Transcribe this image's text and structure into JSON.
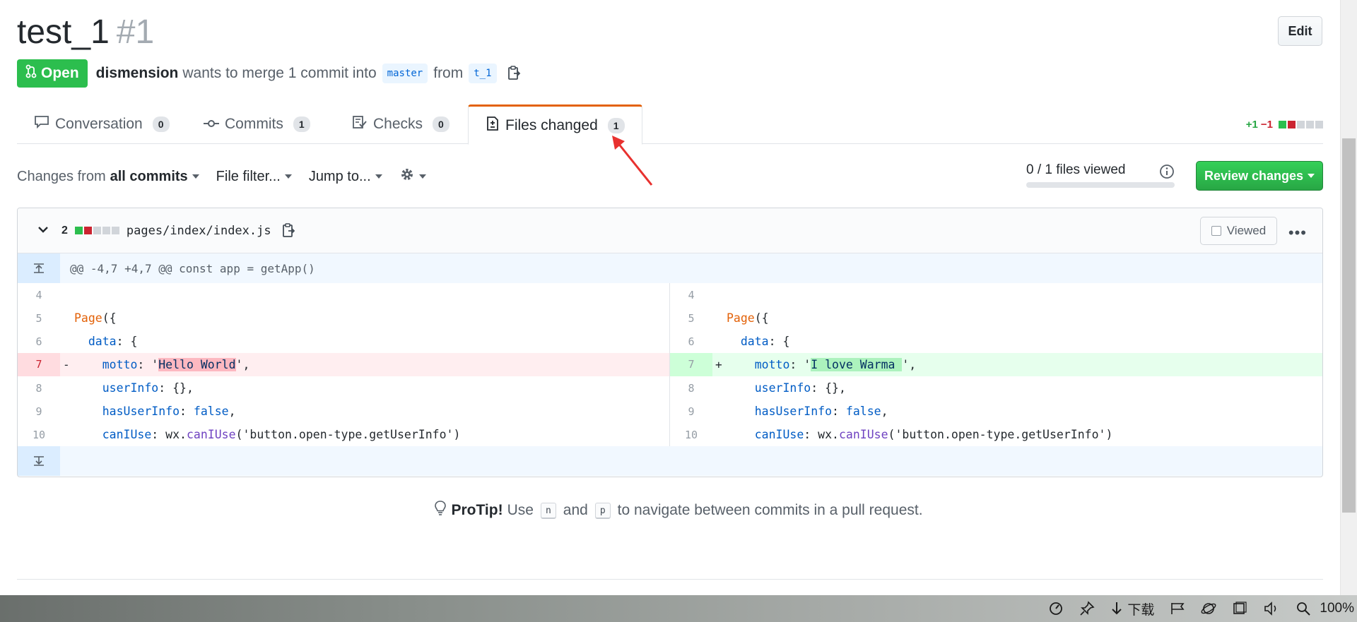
{
  "header": {
    "title": "test_1",
    "number": "#1",
    "edit_label": "Edit",
    "state": "Open",
    "author": "dismension",
    "merge_text": "wants to merge 1 commit into",
    "base_branch": "master",
    "from_text": "from",
    "head_branch": "t_1"
  },
  "tabs": [
    {
      "label": "Conversation",
      "count": "0",
      "icon": "comment-icon"
    },
    {
      "label": "Commits",
      "count": "1",
      "icon": "commit-icon"
    },
    {
      "label": "Checks",
      "count": "0",
      "icon": "checklist-icon"
    },
    {
      "label": "Files changed",
      "count": "1",
      "icon": "file-diff-icon",
      "selected": true
    }
  ],
  "diffstat": {
    "additions": "+1",
    "deletions": "−1"
  },
  "toolbar": {
    "changes_from_label": "Changes from",
    "changes_from_value": "all commits",
    "file_filter": "File filter...",
    "jump_to": "Jump to...",
    "files_viewed": "0 / 1 files viewed",
    "files_viewed_fraction": 0,
    "review_button": "Review changes"
  },
  "file": {
    "change_count": "2",
    "path": "pages/index/index.js",
    "viewed_label": "Viewed",
    "hunk_header": "@@ -4,7 +4,7 @@ const app = getApp()",
    "lines": [
      {
        "left_no": "4",
        "right_no": "4",
        "type": "context"
      },
      {
        "left_no": "5",
        "right_no": "5",
        "type": "context"
      },
      {
        "left_no": "6",
        "right_no": "6",
        "type": "context"
      },
      {
        "left_no": "7",
        "right_no": "7",
        "type": "change",
        "del_marker": "-",
        "add_marker": "+"
      },
      {
        "left_no": "8",
        "right_no": "8",
        "type": "context"
      },
      {
        "left_no": "9",
        "right_no": "9",
        "type": "context"
      },
      {
        "left_no": "10",
        "right_no": "10",
        "type": "context"
      }
    ],
    "code": {
      "page": "Page",
      "page_open": "({",
      "data_key": "data",
      "data_open": ": {",
      "motto_key": "motto",
      "motto_sep": ": '",
      "old_value": "Hello World",
      "new_value": "I love Warma ",
      "motto_end": "',",
      "userinfo_key": "userInfo",
      "userinfo_val": ": {},",
      "hasuser_key": "hasUserInfo",
      "hasuser_sep": ": ",
      "hasuser_val": "false",
      "hasuser_end": ",",
      "caniuse_key": "canIUse",
      "caniuse_sep": ": wx.",
      "caniuse_fn": "canIUse",
      "caniuse_arg": "('button.open-type.getUserInfo')"
    }
  },
  "protip": {
    "label": "ProTip!",
    "use": "Use",
    "key_n": "n",
    "and": "and",
    "key_p": "p",
    "rest": "to navigate between commits in a pull request."
  },
  "statusbar": {
    "download": "下载",
    "zoom": "100%"
  },
  "colors": {
    "open": "#2cbe4e",
    "review": "#28a745",
    "deletion": "#cb2431",
    "annotation_arrow": "#e8312f"
  }
}
